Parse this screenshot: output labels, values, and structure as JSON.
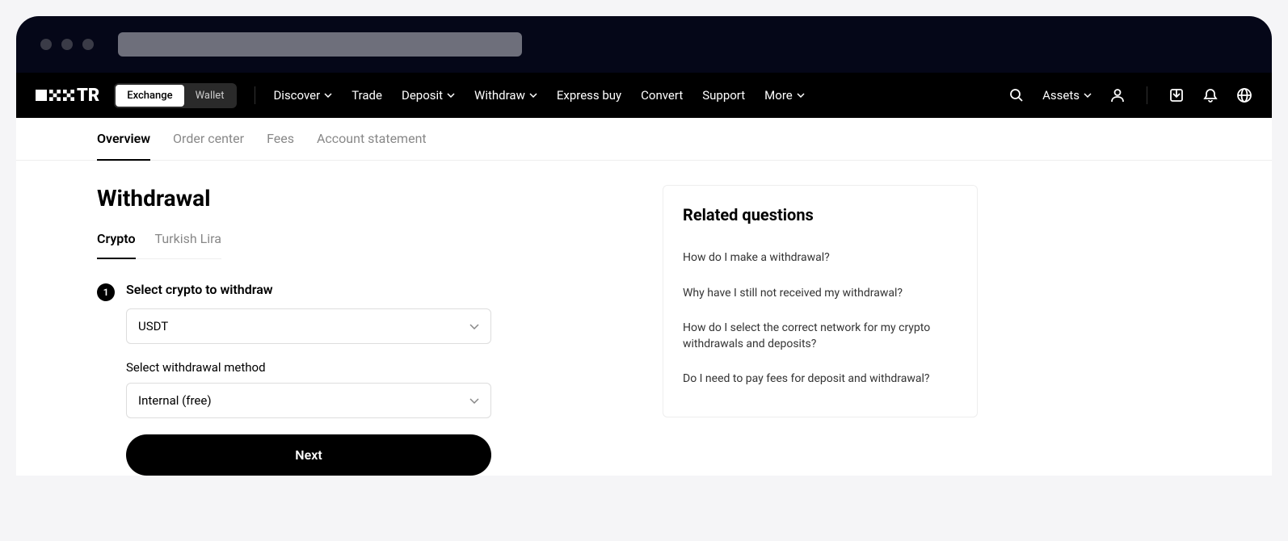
{
  "logo_text": "TR",
  "mode_toggle": {
    "exchange": "Exchange",
    "wallet": "Wallet"
  },
  "nav": {
    "discover": "Discover",
    "trade": "Trade",
    "deposit": "Deposit",
    "withdraw": "Withdraw",
    "express_buy": "Express buy",
    "convert": "Convert",
    "support": "Support",
    "more": "More",
    "assets": "Assets"
  },
  "sub_nav": {
    "overview": "Overview",
    "order_center": "Order center",
    "fees": "Fees",
    "account_statement": "Account statement"
  },
  "page": {
    "title": "Withdrawal",
    "tab_crypto": "Crypto",
    "tab_tl": "Turkish Lira"
  },
  "step1": {
    "number": "1",
    "title": "Select crypto to withdraw",
    "crypto_value": "USDT",
    "method_label": "Select withdrawal method",
    "method_value": "Internal (free)",
    "next_button": "Next"
  },
  "sidebar": {
    "title": "Related questions",
    "items": [
      "How do I make a withdrawal?",
      "Why have I still not received my withdrawal?",
      "How do I select the correct network for my crypto withdrawals and deposits?",
      "Do I need to pay fees for deposit and withdrawal?"
    ]
  }
}
